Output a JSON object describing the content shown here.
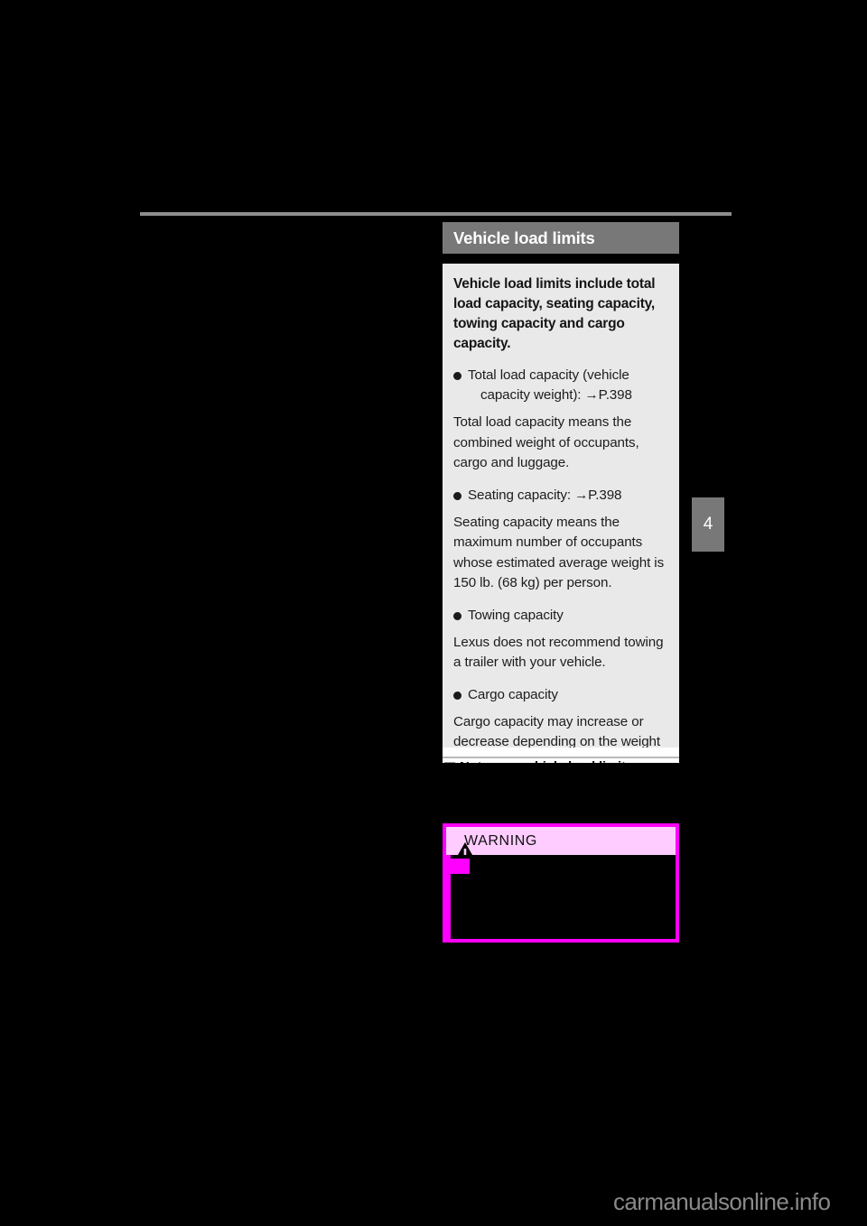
{
  "page": {
    "chapter_tab": "4",
    "watermark": "carmanualsonline.info"
  },
  "section": {
    "title": "Vehicle load limits",
    "lead": "Vehicle load limits include total load capacity, seating capacity, towing capacity and cargo capacity.",
    "items": [
      {
        "bullet_line1": "Total load capacity (vehicle",
        "bullet_line2": "capacity weight): →P.398",
        "body": "Total load capacity means the combined weight of occupants, cargo and luggage."
      },
      {
        "bullet_line1": "Seating capacity: →P.398",
        "bullet_line2": "",
        "body": "Seating capacity means the maximum number of occupants whose estimated average weight is 150 lb. (68 kg) per person."
      },
      {
        "bullet_line1": "Towing capacity",
        "bullet_line2": "",
        "body": "Lexus does not recommend towing a trailer with your vehicle."
      },
      {
        "bullet_line1": "Cargo capacity",
        "bullet_line2": "",
        "body": "Cargo capacity may increase or decrease depending on the weight and the number of occupants."
      }
    ]
  },
  "subsection": {
    "heading": "Notes on vehicle load limits"
  },
  "warning": {
    "label": "WARNING",
    "icon": "warning-triangle-icon"
  },
  "colors": {
    "title_bar": "#787878",
    "content_bg": "#e9e9e9",
    "warning_border": "#ff00ff",
    "warning_header_bg": "#ffccff",
    "page_bg": "#000000",
    "rule": "#8d8d8d"
  }
}
